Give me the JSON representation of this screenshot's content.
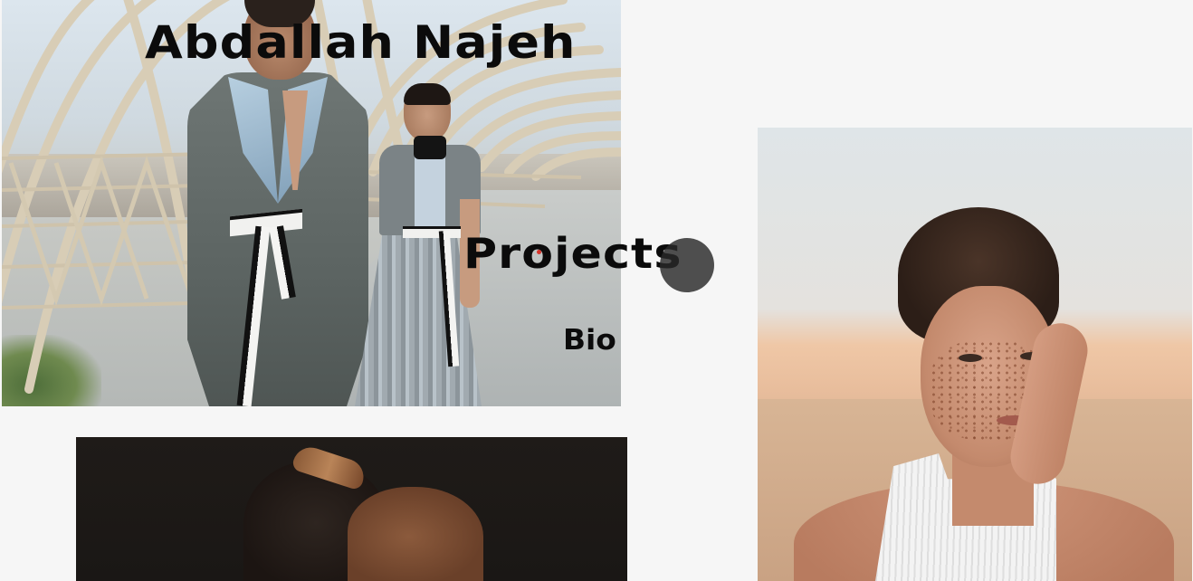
{
  "site": {
    "title": "Abdallah Najeh"
  },
  "nav": {
    "projects_label": "Projects",
    "bio_label": "Bio"
  },
  "photos": [
    {
      "subject": "two models in grey outfits on an arched bridge"
    },
    {
      "subject": "freckled woman in white top, hand on cheek, desert backdrop"
    },
    {
      "subject": "man with eyes closed against dark background"
    }
  ],
  "colors": {
    "background": "#f6f6f6",
    "text": "#0b0b0b",
    "cursor": "#282828"
  }
}
